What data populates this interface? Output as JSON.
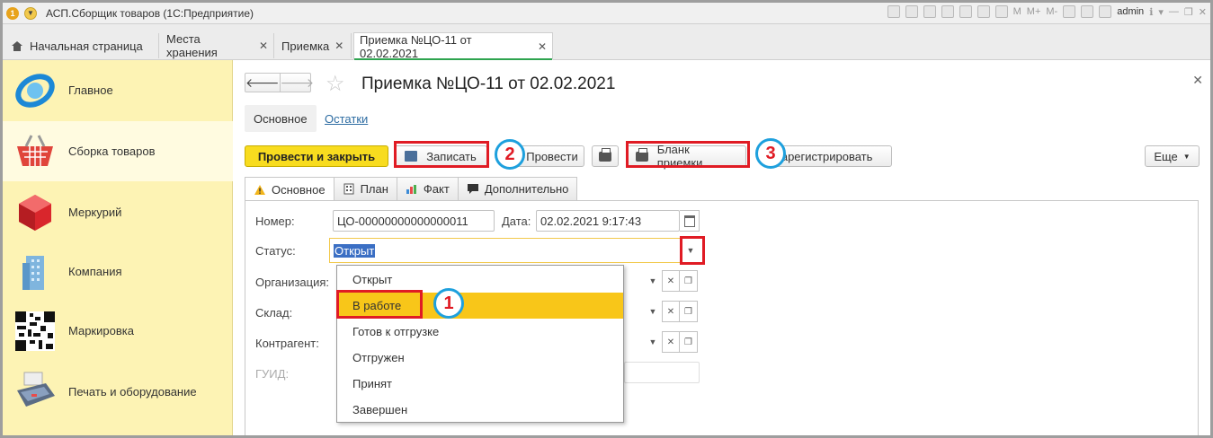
{
  "window": {
    "title": "АСП.Сборщик товаров (1С:Предприятие)",
    "toolbar_labels": [
      "M",
      "M+",
      "M-"
    ],
    "user": "admin"
  },
  "tabs": [
    {
      "label": "Начальная страница",
      "closable": false
    },
    {
      "label": "Места хранения",
      "closable": true
    },
    {
      "label": "Приемка",
      "closable": true
    },
    {
      "label": "Приемка №ЦО-11 от 02.02.2021",
      "closable": true,
      "active": true
    }
  ],
  "sidebar": {
    "items": [
      {
        "label": "Главное",
        "icon": "globe-icon"
      },
      {
        "label": "Сборка товаров",
        "icon": "basket-icon",
        "selected": true
      },
      {
        "label": "Меркурий",
        "icon": "cube-icon"
      },
      {
        "label": "Компания",
        "icon": "building-icon"
      },
      {
        "label": "Маркировка",
        "icon": "qr-code-icon"
      },
      {
        "label": "Печать и оборудование",
        "icon": "payment-terminal-icon"
      }
    ]
  },
  "document": {
    "title": "Приемка №ЦО-11 от 02.02.2021",
    "section_tabs": [
      "Основное",
      "Остатки"
    ]
  },
  "commands": {
    "post_close": "Провести и закрыть",
    "save": "Записать",
    "post": "Провести",
    "print_form": "Бланк приемки",
    "register": "Зарегистрировать",
    "more": "Еще"
  },
  "annotations": [
    "1",
    "2",
    "3"
  ],
  "form_tabs": [
    "Основное",
    "План",
    "Факт",
    "Дополнительно"
  ],
  "fields": {
    "number_label": "Номер:",
    "number_value": "ЦО-00000000000000011",
    "date_label": "Дата:",
    "date_value": "02.02.2021  9:17:43",
    "status_label": "Статус:",
    "status_value": "Открыт",
    "org_label": "Организация:",
    "warehouse_label": "Склад:",
    "contractor_label": "Контрагент:",
    "guid_label": "ГУИД:"
  },
  "status_options": [
    "Открыт",
    "В работе",
    "Готов к отгрузке",
    "Отгружен",
    "Принят",
    "Завершен"
  ],
  "highlighted_option": "В работе",
  "colors": {
    "primary_button": "#f8dc1f",
    "sidebar_bg": "#fdf3b4",
    "highlight": "#f8c619",
    "annotation_box": "#e01b24",
    "annotation_circle": "#1ea0dd"
  }
}
